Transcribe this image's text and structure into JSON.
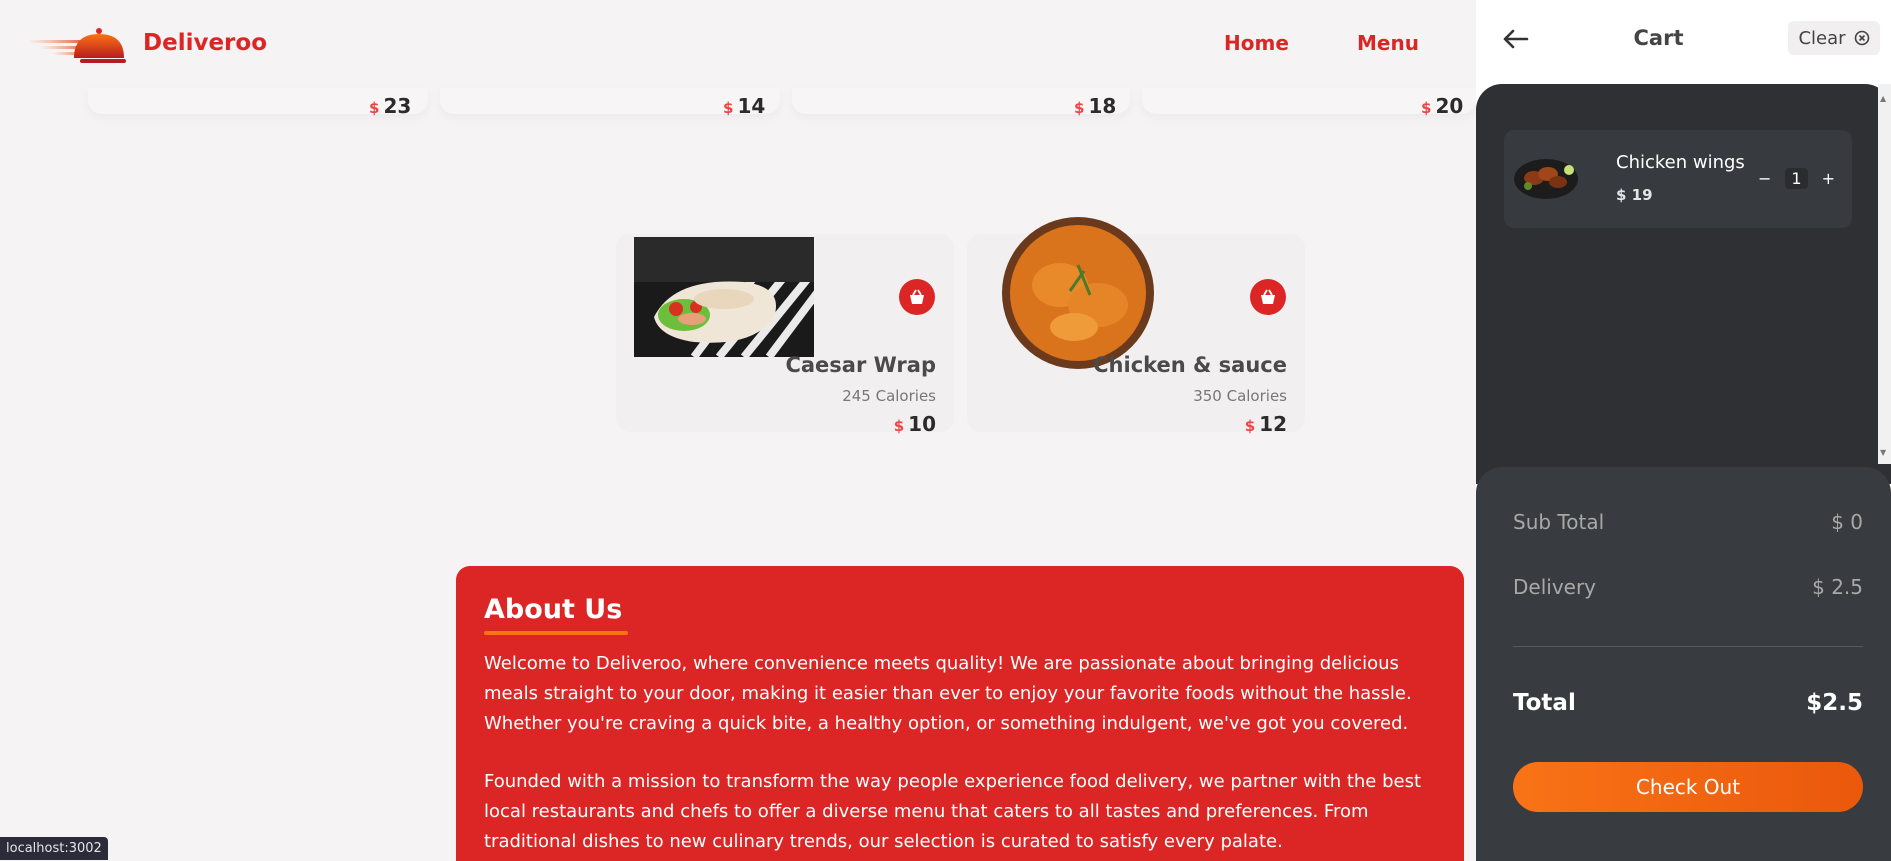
{
  "brand": {
    "name": "Deliveroo",
    "color": "#dc2626"
  },
  "nav": {
    "home": "Home",
    "menu": "Menu"
  },
  "currency": "$",
  "top_prices": [
    "23",
    "14",
    "18",
    "20"
  ],
  "items": [
    {
      "name": "Caesar Wrap",
      "calories": "245 Calories",
      "price": "10",
      "icon": "basket-icon"
    },
    {
      "name": "Chicken & sauce",
      "calories": "350 Calories",
      "price": "12",
      "icon": "basket-icon"
    }
  ],
  "about": {
    "title": "About Us",
    "paragraphs": [
      "Welcome to Deliveroo, where convenience meets quality! We are passionate about bringing delicious meals straight to your door, making it easier than ever to enjoy your favorite foods without the hassle. Whether you're craving a quick bite, a healthy option, or something indulgent, we've got you covered.",
      "Founded with a mission to transform the way people experience food delivery, we partner with the best local restaurants and chefs to offer a diverse menu that caters to all tastes and preferences. From traditional dishes to new culinary trends, our selection is curated to satisfy every palate."
    ]
  },
  "status_bar": "localhost:3002",
  "cart": {
    "title": "Cart",
    "clear_label": "Clear",
    "items": [
      {
        "name": "Chicken wings",
        "price": "$ 19",
        "quantity": "1",
        "minus": "−",
        "plus": "+"
      }
    ],
    "subtotal_label": "Sub Total",
    "subtotal_value": "$ 0",
    "delivery_label": "Delivery",
    "delivery_value": "$ 2.5",
    "total_label": "Total",
    "total_value": "$2.5",
    "checkout_label": "Check Out"
  },
  "colors": {
    "accent": "#dc2626",
    "orange": "#f97316",
    "cart_dark": "#2e3033"
  }
}
